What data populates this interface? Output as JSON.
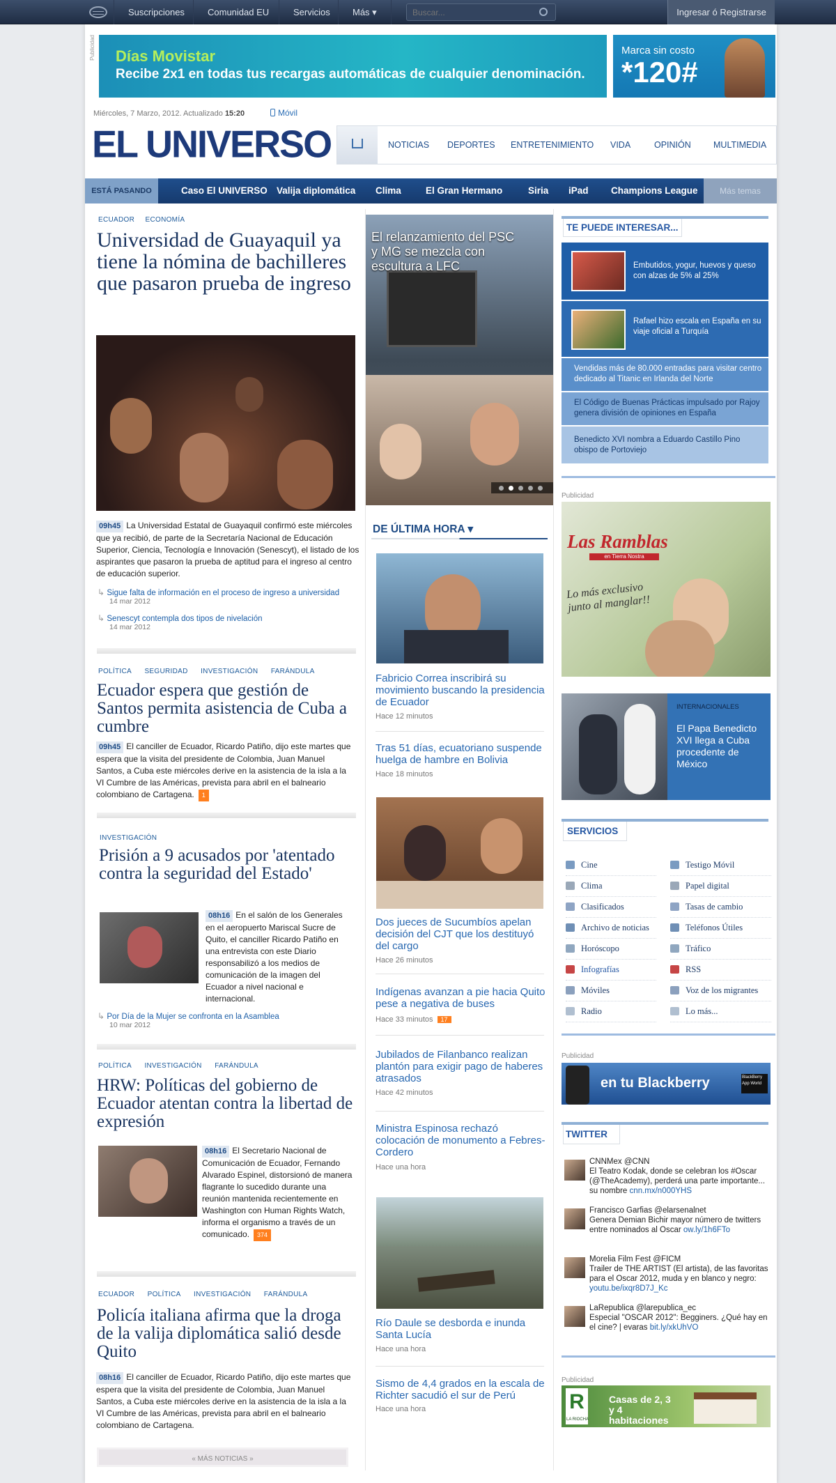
{
  "topbar": {
    "items": [
      "Suscripciones",
      "Comunidad EU",
      "Servicios",
      "Más ▾"
    ],
    "search_placeholder": "Buscar...",
    "login": "Ingresar ó Registrarse"
  },
  "ads": {
    "publicidad": "Publicidad",
    "movistar_title": "Días Movistar",
    "movistar_text": "Recibe 2x1 en todas tus recargas automáticas de cualquier denominación.",
    "marca": "Marca sin costo",
    "code": "*120#"
  },
  "header": {
    "date": "Miércoles, 7 Marzo, 2012. Actualizado",
    "time": "15:20",
    "movil": "Móvil",
    "logo": "EL UNIVERSO",
    "nav": [
      "NOTICIAS",
      "DEPORTES",
      "ENTRETENIMIENTO",
      "VIDA",
      "OPINIÓN",
      "MULTIMEDIA"
    ]
  },
  "hot": {
    "label": "ESTÁ PASANDO",
    "items": [
      "Caso El UNIVERSO",
      "Valija diplomática",
      "Clima",
      "El Gran Hermano",
      "Siria",
      "iPad",
      "Champions League"
    ],
    "more": "Más temas"
  },
  "lead": {
    "tags": [
      "ECUADOR",
      "ECONOMÍA"
    ],
    "title": "Universidad de Guayaquil ya tiene la nómina de bachilleres que pasaron prueba de ingreso",
    "time": "09h45",
    "text": "La Universidad Estatal de Guayaquil confirmó este miércoles que ya recibió, de parte de la Secretaría Nacional de Educación Superior, Ciencia, Tecnología e Innovación (Senescyt), el listado de los aspirantes que pasaron la prueba de aptitud para el ingreso al centro de educación superior.",
    "related": [
      {
        "t": "Sigue falta de información en el proceso de ingreso a universidad",
        "d": "14 mar 2012"
      },
      {
        "t": "Senescyt contempla dos tipos de nivelación",
        "d": "14 mar 2012"
      }
    ]
  },
  "a2": {
    "tags": [
      "POLÍTICA",
      "SEGURIDAD",
      "INVESTIGACIÓN",
      "FARÁNDULA"
    ],
    "title": "Ecuador espera que gestión de Santos permita asistencia de Cuba a cumbre",
    "time": "09h45",
    "text": "El canciller de Ecuador, Ricardo Patiño, dijo este martes que espera que la visita del presidente de Colombia, Juan Manuel Santos, a Cuba este miércoles derive en la asistencia de la isla a la VI Cumbre de las Américas, prevista para abril en el balneario colombiano de Cartagena.",
    "count": "1"
  },
  "a3": {
    "tags": [
      "INVESTIGACIÓN"
    ],
    "title": "Prisión a 9 acusados por 'atentado contra la seguridad del Estado'",
    "time": "08h16",
    "text": "En el salón de los Generales en el aeropuerto Mariscal Sucre de Quito, el canciller Ricardo Patiño en una entrevista con este Diario responsabilizó a los medios de comunicación de la imagen del Ecuador a nivel nacional e internacional.",
    "related": {
      "t": "Por Día de la Mujer se confronta en la Asamblea",
      "d": "10 mar 2012"
    }
  },
  "a4": {
    "tags": [
      "POLÍTICA",
      "INVESTIGACIÓN",
      "FARÁNDULA"
    ],
    "title": "HRW: Políticas del gobierno de Ecuador atentan contra la libertad de expresión",
    "time": "08h16",
    "text": "El Secretario Nacional de Comunicación de Ecuador, Fernando Alvarado Espinel, distorsionó de manera flagrante lo sucedido durante una reunión mantenida recientemente en Washington con Human Rights Watch, informa el organismo a través de un comunicado.",
    "count": "374"
  },
  "a5": {
    "tags": [
      "ECUADOR",
      "POLÍTICA",
      "INVESTIGACIÓN",
      "FARÁNDULA"
    ],
    "title": "Policía italiana afirma que la droga de la valija diplomática salió desde Quito",
    "time": "08h16",
    "text": "El canciller de Ecuador, Ricardo Patiño, dijo este martes que espera que la visita del presidente de Colombia, Juan Manuel Santos, a Cuba este miércoles derive en la asistencia de la isla a la VI Cumbre de las Américas, prevista para abril en el balneario colombiano de Cartagena.",
    "more": "« MÁS NOTICIAS »"
  },
  "slider": {
    "caption": "El relanzamiento del PSC y MG se mezcla con escultura a LFC"
  },
  "ultima": {
    "title": "DE ÚLTIMA HORA ▾",
    "items": [
      {
        "t": "Fabricio Correa inscribirá su movimiento buscando la presidencia de Ecuador",
        "d": "Hace 12 minutos"
      },
      {
        "t": "Tras 51 días, ecuatoriano suspende huelga de hambre en Bolivia",
        "d": "Hace 18 minutos"
      },
      {
        "t": "Dos jueces de Sucumbíos apelan decisión del CJT que los destituyó del cargo",
        "d": "Hace 26 minutos"
      },
      {
        "t": "Indígenas avanzan a pie hacia Quito pese a negativa de buses",
        "d": "Hace 33 minutos",
        "c": "17"
      },
      {
        "t": "Jubilados de Filanbanco realizan plantón para exigir pago de haberes atrasados",
        "d": "Hace 42 minutos"
      },
      {
        "t": "Ministra Espinosa rechazó colocación de monumento a Febres-Cordero",
        "d": "Hace una hora"
      },
      {
        "t": "Río Daule se desborda e inunda Santa Lucía",
        "d": "Hace una hora"
      },
      {
        "t": "Sismo de 4,4 grados en la escala de Richter sacudió el sur de Perú",
        "d": "Hace una hora"
      }
    ]
  },
  "interesar": {
    "title": "TE PUEDE INTERESAR...",
    "items": [
      "Embutidos, yogur, huevos y queso con alzas de 5% al 25%",
      "Rafael hizo escala en España en su viaje oficial a Turquía",
      "Vendidas más de 80.000 entradas para visitar centro dedicado al Titanic en Irlanda del Norte",
      "El Código de Buenas Prácticas impulsado por Rajoy genera división de opiniones en España",
      "Benedicto XVI nombra a Eduardo Castillo Pino obispo de Portoviejo"
    ]
  },
  "ramblas": {
    "pub": "Publicidad",
    "name": "Las Ramblas",
    "sub": "en Tierra Nostra",
    "text": "Lo más exclusivo junto al manglar!!"
  },
  "intl": {
    "tag": "INTERNACIONALES",
    "title": "El Papa Benedicto XVI llega a Cuba procedente de México"
  },
  "servicios": {
    "title": "SERVICIOS",
    "left": [
      "Cine",
      "Clima",
      "Clasificados",
      "Archivo de noticias",
      "Horóscopo",
      "Infografías",
      "Móviles",
      "Radio"
    ],
    "right": [
      "Testigo Móvil",
      "Papel digital",
      "Tasas de cambio",
      "Teléfonos Útiles",
      "Tráfico",
      "RSS",
      "Voz de los migrantes",
      "Lo más..."
    ]
  },
  "bb": {
    "pub": "Publicidad",
    "text": "en tu Blackberry",
    "appworld": "BlackBerry App World"
  },
  "twitter": {
    "title": "TWITTER",
    "items": [
      {
        "u": "CNNMex @CNN",
        "t": "El Teatro Kodak, donde se celebran los #Oscar (@TheAcademy), perderá una parte importante... su nombre",
        "l": "cnn.mx/n000YHS"
      },
      {
        "u": "Francisco Garfias  @elarsenalnet",
        "t": "Genera Demian Bichir mayor número de twitters entre nominados al Oscar",
        "l": "ow.ly/1h6FTo"
      },
      {
        "u": "Morelia Film Fest @FICM",
        "t": "Trailer de THE ARTIST (El artista), de las favoritas para el Oscar 2012, muda y en blanco y negro:",
        "l": "youtu.be/ixqr8D7J_Kc"
      },
      {
        "u": "LaRepublica @larepublica_ec",
        "t": "Especial \"OSCAR 2012\": Begginers. ¿Qué hay en el cine? | evaras",
        "l": "bit.ly/xkUhVO"
      }
    ]
  },
  "lariocha": {
    "pub": "Publicidad",
    "brand": "LA RIOCHA",
    "text": "Casas de 2, 3 y 4 habitaciones"
  }
}
